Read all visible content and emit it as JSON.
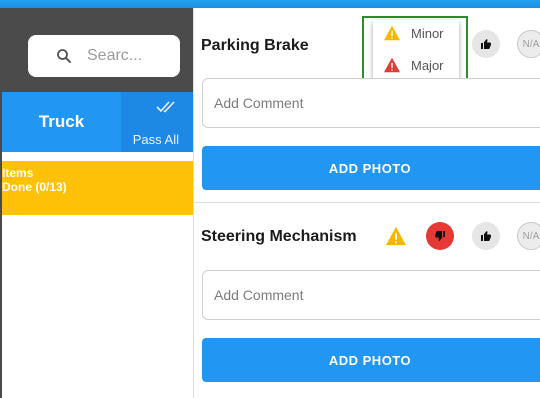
{
  "sidebar": {
    "search": {
      "placeholder": "Searc..."
    },
    "tab_label": "Truck",
    "pass_all_label": "Pass All",
    "items_label": "Items",
    "items_done": "Done (0/13)"
  },
  "inspection": {
    "items": [
      {
        "title": "Parking Brake",
        "comment_placeholder": "Add Comment",
        "photo_label": "ADD PHOTO",
        "na_label": "N/A"
      },
      {
        "title": "Steering Mechanism",
        "comment_placeholder": "Add Comment",
        "photo_label": "ADD PHOTO",
        "na_label": "N/A"
      }
    ],
    "defect_menu": {
      "minor_label": "Minor",
      "major_label": "Major"
    }
  },
  "colors": {
    "primary": "#2196f3",
    "sidebar_dark": "#4b4b4b",
    "items_highlight": "#ffc107",
    "warning_amber": "#f5b700",
    "danger_red": "#e53935",
    "highlight_border": "#2e8b2e"
  },
  "icons": {
    "search": "search-icon",
    "pass_all": "double-check-icon",
    "minor": "warning-triangle-amber-icon",
    "major": "warning-triangle-red-icon",
    "thumbs_up": "thumbs-up-icon",
    "thumbs_down": "thumbs-down-icon"
  }
}
